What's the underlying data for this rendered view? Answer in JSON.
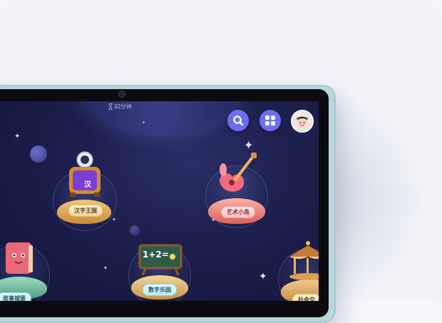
{
  "screen": {
    "timer_text": "32分钟"
  },
  "top_bar": {
    "search_icon": "search-icon",
    "apps_icon": "grid-icon",
    "avatar": "child-avatar"
  },
  "islands": [
    {
      "label": "汉字王国",
      "sign_text": "汉",
      "icon": "astronaut-tv-icon"
    },
    {
      "label": "艺术小岛",
      "icon": "guitar-icon"
    },
    {
      "label": "故事城堡",
      "icon": "book-icon"
    },
    {
      "label": "数字乐园",
      "board_text": "1+2=",
      "icon": "chalkboard-icon"
    },
    {
      "label": "社会交",
      "icon": "carousel-icon"
    }
  ],
  "colors": {
    "accent": "#6e6df0",
    "space_bg": "#1d1f4e",
    "tablet_frame": "#b9d6dc"
  }
}
